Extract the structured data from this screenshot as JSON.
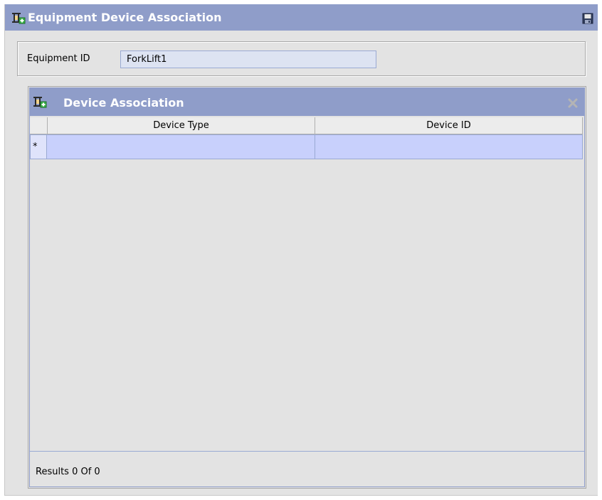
{
  "window": {
    "title": "Equipment Device Association",
    "title_icon": "equipment-icon",
    "save_icon": "save-icon"
  },
  "equipment": {
    "label": "Equipment ID",
    "value": "ForkLift1"
  },
  "device_association": {
    "title": "Device Association",
    "header_icon": "equipment-icon",
    "delete_icon": "delete-icon",
    "columns": [
      "Device Type",
      "Device ID"
    ],
    "new_row_marker": "*",
    "rows": [
      {
        "device_type": "",
        "device_id": ""
      }
    ]
  },
  "footer": {
    "results_text": "Results 0  Of 0"
  },
  "colors": {
    "titlebar": "#8f9dc9",
    "panel_bg": "#e3e3e3",
    "selected_row": "#c8d0fc",
    "input_bg": "#dde3f2"
  }
}
